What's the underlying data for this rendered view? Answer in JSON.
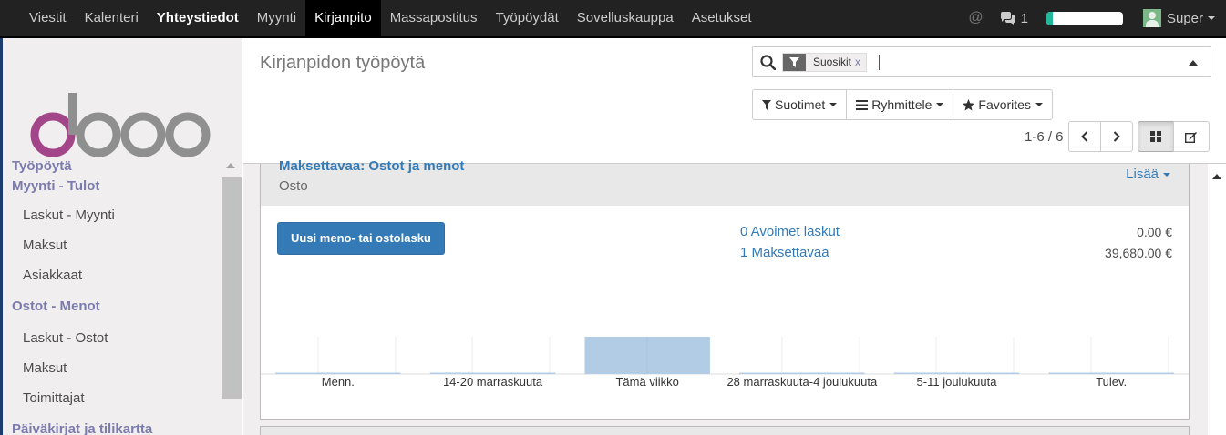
{
  "topbar": {
    "menu": [
      {
        "label": "Viestit"
      },
      {
        "label": "Kalenteri"
      },
      {
        "label": "Yhteystiedot"
      },
      {
        "label": "Myynti"
      },
      {
        "label": "Kirjanpito"
      },
      {
        "label": "Massapostitus"
      },
      {
        "label": "Työpöydät"
      },
      {
        "label": "Sovelluskauppa"
      },
      {
        "label": "Asetukset"
      }
    ],
    "at_symbol": "@",
    "chat_count": "1",
    "progress_fraction": 0.08,
    "progress_color": "#21b799",
    "user_name": "Super"
  },
  "sidebar": {
    "logo_text": "odoo",
    "items": [
      {
        "type": "section",
        "label": "Työpöytä"
      },
      {
        "type": "section",
        "label": "Myynti - Tulot"
      },
      {
        "type": "link",
        "label": "Laskut - Myynti"
      },
      {
        "type": "link",
        "label": "Maksut"
      },
      {
        "type": "link",
        "label": "Asiakkaat"
      },
      {
        "type": "section",
        "label": "Ostot - Menot"
      },
      {
        "type": "link",
        "label": "Laskut - Ostot"
      },
      {
        "type": "link",
        "label": "Maksut"
      },
      {
        "type": "link",
        "label": "Toimittajat"
      },
      {
        "type": "section",
        "label": "Päiväkirjat ja tilikartta"
      }
    ]
  },
  "control_panel": {
    "title": "Kirjanpidon työpöytä",
    "search": {
      "facet_value": "Suosikit",
      "facet_remove": "x"
    },
    "filter_buttons": {
      "filters": "Suotimet",
      "group_by": "Ryhmittele",
      "favorites": "Favorites"
    },
    "pager": "1-6 / 6"
  },
  "journal": {
    "name": "Maksettavaa: Ostot ja menot",
    "type": "Osto",
    "more": "Lisää",
    "new_button": "Uusi meno- tai ostolasku",
    "stats": [
      {
        "label": "0 Avoimet laskut",
        "amount": "0.00 €"
      },
      {
        "label": "1 Maksettavaa",
        "amount": "39,680.00 €"
      }
    ]
  },
  "chart_data": {
    "type": "bar",
    "categories": [
      "Menn.",
      "14-20 marraskuuta",
      "Tämä viikko",
      "28 marraskuuta-4 joulukuuta",
      "5-11 joulukuuta",
      "Tulev."
    ],
    "values": [
      0,
      0,
      39680,
      0,
      0,
      0
    ],
    "bar_color": "#b3cce6",
    "ylim": [
      0,
      39680
    ],
    "grid": true
  }
}
